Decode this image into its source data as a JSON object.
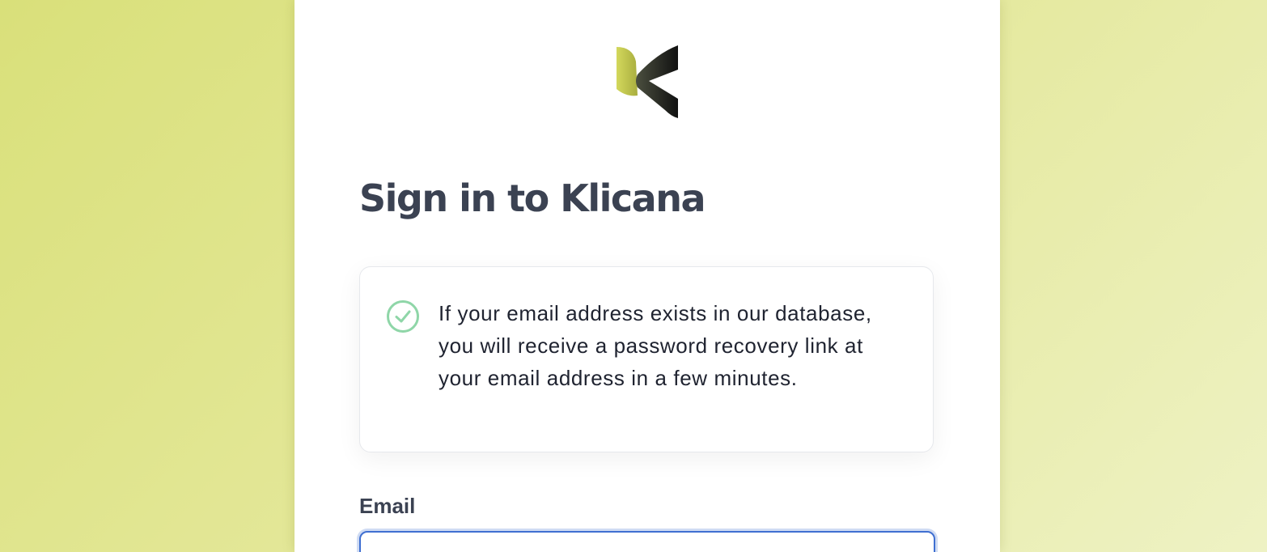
{
  "page": {
    "title": "Sign in to Klicana"
  },
  "logo": {
    "icon": "klicana-logo-icon",
    "brand_colors": {
      "left_leaf_light": "#d3d85c",
      "left_leaf_dark": "#a9ae3f",
      "right_chevron_light": "#4b4f3f",
      "right_chevron_dark": "#111111"
    }
  },
  "alert": {
    "icon": "check-circle-icon",
    "icon_color": "#8fd6a8",
    "message": "If your email address exists in our database, you will receive a password recovery link at your email address in a few minutes."
  },
  "form": {
    "email_label": "Email",
    "email_value": "",
    "focus_color": "#3f6fd1"
  }
}
